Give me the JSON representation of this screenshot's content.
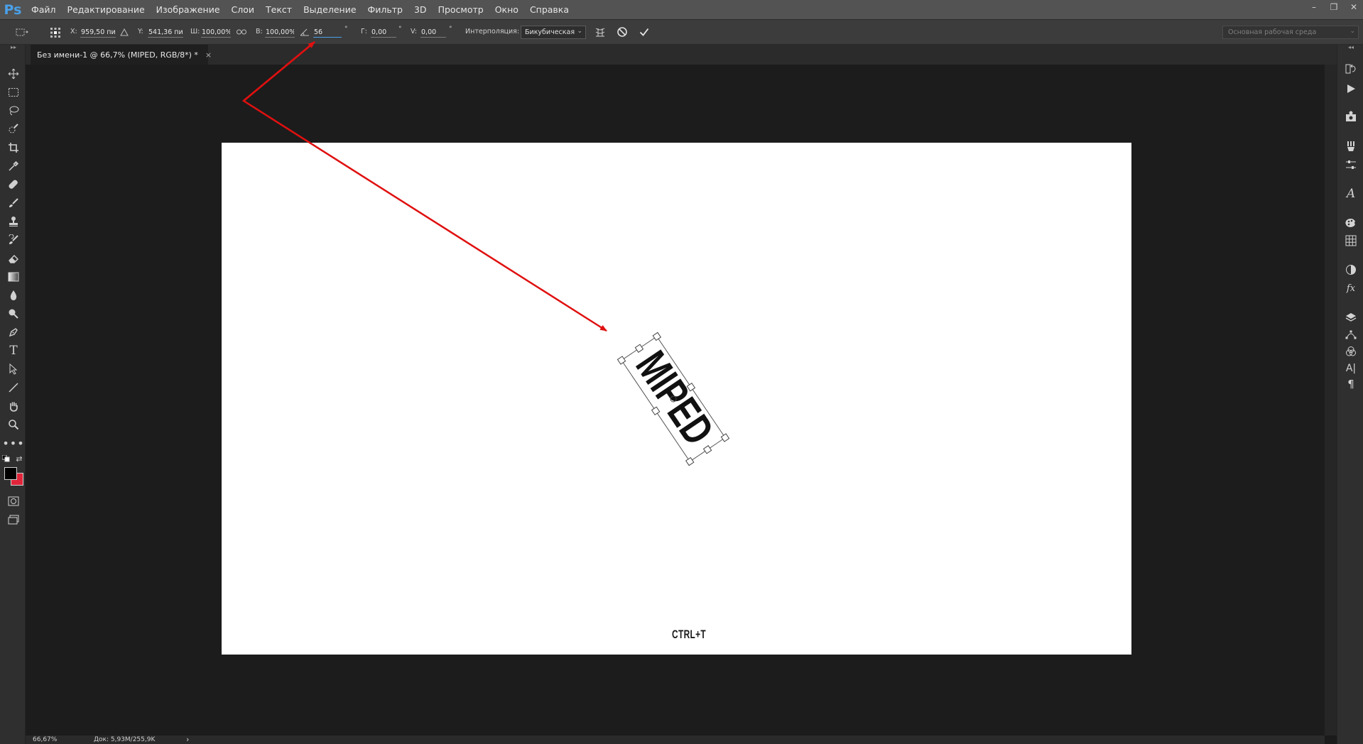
{
  "app": {
    "logo": "Ps"
  },
  "menu": [
    "Файл",
    "Редактирование",
    "Изображение",
    "Слои",
    "Текст",
    "Выделение",
    "Фильтр",
    "3D",
    "Просмотр",
    "Окно",
    "Справка"
  ],
  "window_controls": {
    "minimize": "–",
    "restore": "❐",
    "close": "✕"
  },
  "options": {
    "x_label": "X:",
    "x_value": "959,50 пи",
    "y_label": "Y:",
    "y_value": "541,36 пи",
    "w_label": "Ш:",
    "w_value": "100,00%",
    "h_label": "В:",
    "h_value": "100,00%",
    "angle_value": "56",
    "hskew_label": "Г:",
    "hskew_value": "0,00",
    "vskew_label": "V:",
    "vskew_value": "0,00",
    "degree_symbol": "°",
    "interp_label": "Интерполяция:",
    "interp_value": "Бикубическая",
    "workspace": "Основная рабочая среда"
  },
  "document": {
    "tab_title": "Без имени-1 @ 66,7% (MIPED, RGB/8*) *",
    "tab_close": "×"
  },
  "canvas": {
    "layer_text": "MIPED",
    "caption": "CTRL+T",
    "rotation_deg": 56,
    "annotation_color": "#e01010"
  },
  "status": {
    "zoom": "66,67%",
    "doc_info": "Док: 5,93M/255,9K",
    "arrow": "›"
  },
  "colors": {
    "foreground": "#000000",
    "background": "#e0243a",
    "accent": "#4aa0e8"
  },
  "tool_icons": [
    "move-icon",
    "marquee-icon",
    "lasso-icon",
    "quick-select-icon",
    "crop-icon",
    "eyedropper-icon",
    "healing-icon",
    "brush-icon",
    "stamp-icon",
    "history-brush-icon",
    "eraser-icon",
    "gradient-icon",
    "blur-icon",
    "dodge-icon",
    "pen-icon",
    "type-icon",
    "path-select-icon",
    "line-icon",
    "hand-icon",
    "zoom-icon",
    "more-icon"
  ],
  "panel_icons": [
    "history-icon",
    "actions-icon",
    "properties-icon",
    "brushes-icon",
    "adjust-icon",
    "glyphs-icon",
    "swatches-icon",
    "grid-icon",
    "styles-icon",
    "fx-icon",
    "layers-icon",
    "paths-icon",
    "channels-icon",
    "character-icon",
    "paragraph-icon"
  ]
}
